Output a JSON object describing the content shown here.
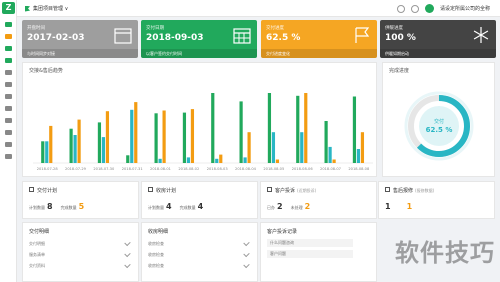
{
  "app": {
    "logo_text": "Z",
    "brand": "集团项目管理 ∨",
    "user": "请设定所属公司的全称",
    "colors": {
      "green": "#21a95c",
      "blue": "#2a9fd8",
      "orange": "#f39c12",
      "gray": "#9e9e9e",
      "dark": "#444444",
      "teal": "#29b6c4"
    }
  },
  "cards": [
    {
      "label": "开盘时间",
      "value": "2017-02-03",
      "foot": "与时间同步对接",
      "color": "#9e9e9e",
      "icon": "calendar-icon"
    },
    {
      "label": "交付日期",
      "value": "2018-09-03",
      "foot": "以客户签约交付时间",
      "color": "#21a95c",
      "icon": "grid-calendar-icon"
    },
    {
      "label": "交付进度",
      "value": "62.5 %",
      "foot": "交付进度变化",
      "color": "#f5a623",
      "icon": "flag-icon"
    },
    {
      "label": "供暖进度",
      "value": "100 %",
      "foot": "供暖如期启动",
      "color": "#444444",
      "icon": "snowflake-icon"
    }
  ],
  "chart_data": {
    "type": "bar",
    "title": "交接&售后趋势",
    "categories": [
      "2018-07-28",
      "2018-07-29",
      "2018-07-30",
      "2018-07-31",
      "2018-08-01",
      "2018-08-02",
      "2018-08-03",
      "2018-08-04",
      "2018-08-05",
      "2018-08-06",
      "2018-08-07",
      "2018-08-08"
    ],
    "series": [
      {
        "color": "#21a95c",
        "values": [
          31,
          49,
          58,
          11,
          71,
          72,
          100,
          88,
          100,
          96,
          60,
          95
        ]
      },
      {
        "color": "#29b6c4",
        "values": [
          31,
          40,
          37,
          76,
          6,
          8,
          6,
          8,
          44,
          44,
          23,
          20
        ]
      },
      {
        "color": "#f39c12",
        "values": [
          53,
          62,
          74,
          87,
          75,
          77,
          12,
          44,
          5,
          100,
          5,
          44
        ]
      }
    ],
    "ylim": [
      0,
      100
    ]
  },
  "donut": {
    "title": "完成进度",
    "label": "交付",
    "value": "62.5 %",
    "percent": 62.5
  },
  "stats": [
    {
      "title": "交付计划",
      "sub": "",
      "k1": "计划数量",
      "v1": "8",
      "k2": "完成数量",
      "v2": "5",
      "icon": "hand-icon"
    },
    {
      "title": "收房计划",
      "sub": "",
      "k1": "计划数量",
      "v1": "4",
      "k2": "完成数量",
      "v2": "4",
      "icon": "house-key-icon"
    },
    {
      "title": "客户投诉",
      "sub": "(近期投诉)",
      "k1": "已办",
      "v1": "2",
      "k2": "未处理",
      "v2": "2",
      "icon": "people-icon"
    },
    {
      "title": "售后报修",
      "sub": "(报修数据)",
      "k1": "",
      "v1": "1",
      "k2": "",
      "v2": "1",
      "icon": "wrench-icon"
    }
  ],
  "lists": [
    {
      "title": "交付明细",
      "rows": [
        "交付明细",
        "服务清单",
        "交付资料"
      ]
    },
    {
      "title": "收房明细",
      "rows": [
        "收房检查",
        "收房检查",
        "收房检查"
      ]
    },
    {
      "title": "客户投诉记录",
      "rows": [
        "什么问题咨询",
        "客户问题"
      ]
    }
  ],
  "watermark": "软件技巧"
}
